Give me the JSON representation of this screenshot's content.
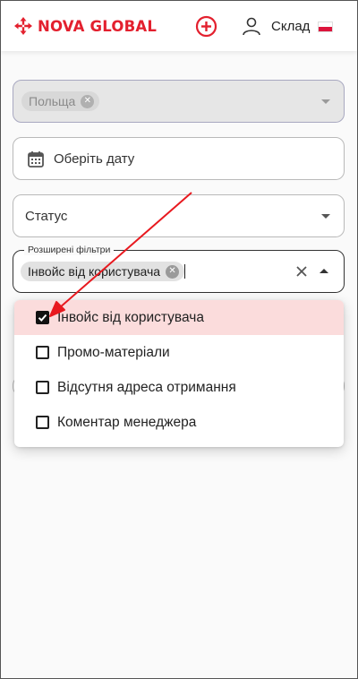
{
  "header": {
    "brand": "NOVA GLOBAL",
    "warehouse_label": "Склад",
    "brand_color": "#e3202e"
  },
  "filters": {
    "country": {
      "chip": "Польща"
    },
    "date": {
      "placeholder": "Оберіть дату"
    },
    "status": {
      "placeholder": "Статус"
    },
    "extended": {
      "legend": "Розширені фільтри",
      "chip": "Інвойс від користувача"
    }
  },
  "dropdown": {
    "options": [
      {
        "label": "Інвойс від користувача",
        "checked": true
      },
      {
        "label": "Промо-матеріали",
        "checked": false
      },
      {
        "label": "Відсутня адреса отримання",
        "checked": false
      },
      {
        "label": "Коментар менеджера",
        "checked": false
      }
    ]
  },
  "annotation": {
    "color": "#e8191f"
  }
}
